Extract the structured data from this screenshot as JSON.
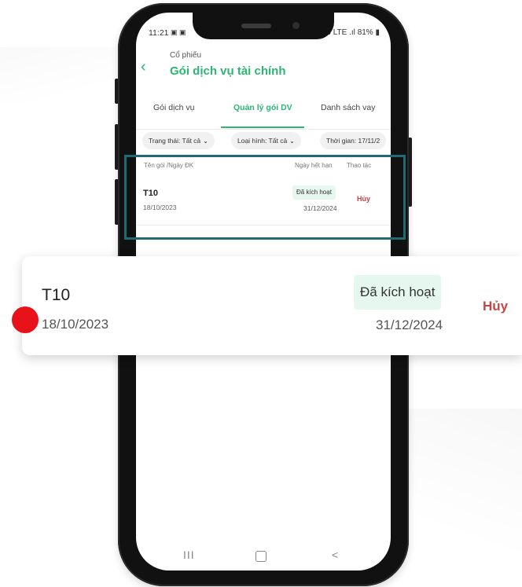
{
  "status_bar": {
    "time": "11:21",
    "left_icons": "▣ ▣",
    "battery": "81%",
    "signal": "Vo LTE .ıl"
  },
  "header": {
    "subtitle": "Cổ phiếu",
    "title": "Gói dịch vụ tài chính"
  },
  "tabs": [
    {
      "label": "Gói dịch vụ",
      "active": false
    },
    {
      "label": "Quản lý gói DV",
      "active": true
    },
    {
      "label": "Danh sách vay",
      "active": false
    }
  ],
  "filters": [
    {
      "label": "Trạng thái: Tất cả"
    },
    {
      "label": "Loại hình: Tất cả"
    },
    {
      "label": "Thời gian: 17/11/2"
    }
  ],
  "columns": {
    "name": "Tên gói /Ngày ĐK",
    "expiry": "Ngày hết hạn",
    "action": "Thao tác"
  },
  "package_row": {
    "name": "T10",
    "register_date": "18/10/2023",
    "status": "Đã kích hoạt",
    "expiry_date": "31/12/2024",
    "cancel_label": "Hủy"
  },
  "nav_bar": {
    "recent": "III",
    "back": "<"
  },
  "colors": {
    "accent": "#2bb673",
    "highlight_border": "#1f6a73",
    "cancel": "#d23c3c",
    "badge_bg": "#e6f7ef",
    "marker": "#e8121b"
  }
}
